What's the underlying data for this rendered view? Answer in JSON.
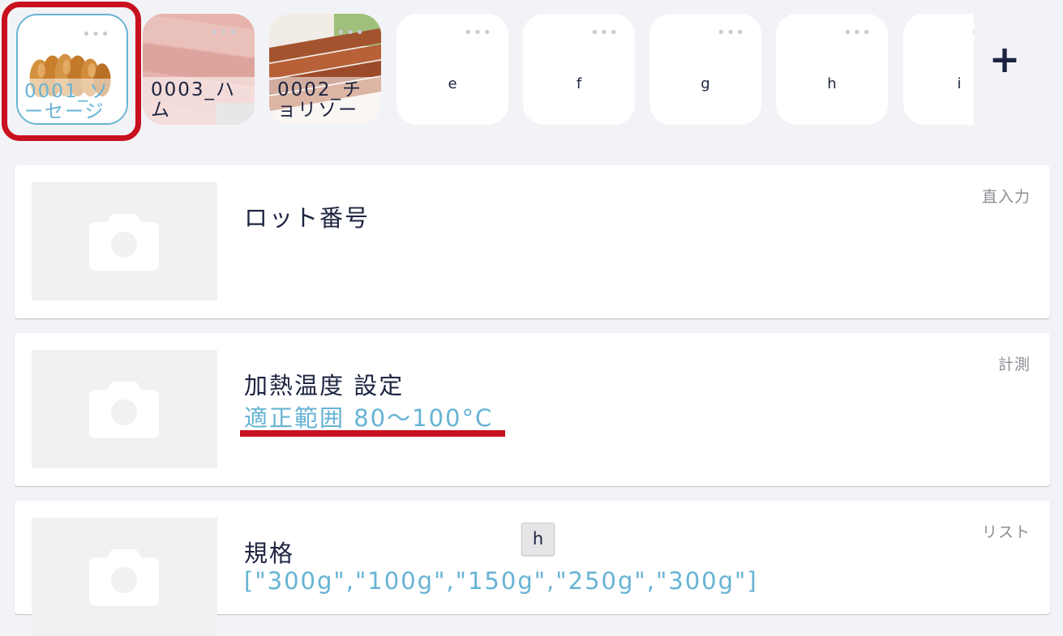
{
  "product_tabs": [
    {
      "name": "0001_ソーセージ",
      "selected": true,
      "menu_icon": "more-dots-icon"
    },
    {
      "name": "0003_ハム",
      "selected": false,
      "menu_icon": "more-dots-icon"
    },
    {
      "name": "0002_チョリソー",
      "selected": false,
      "menu_icon": "more-dots-icon"
    },
    {
      "name": "e",
      "selected": false,
      "menu_icon": "more-dots-icon"
    },
    {
      "name": "f",
      "selected": false,
      "menu_icon": "more-dots-icon"
    },
    {
      "name": "g",
      "selected": false,
      "menu_icon": "more-dots-icon"
    },
    {
      "name": "h",
      "selected": false,
      "menu_icon": "more-dots-icon"
    },
    {
      "name": "i",
      "selected": false,
      "menu_icon": "more-dots-icon"
    }
  ],
  "add_button": {
    "label": "+",
    "icon": "plus-icon"
  },
  "items": [
    {
      "title": "ロット番号",
      "subtitle": "",
      "type": "直入力",
      "image_icon": "camera-icon"
    },
    {
      "title": "加熱温度 設定",
      "subtitle": "適正範囲 80〜100°C",
      "type": "計測",
      "image_icon": "camera-icon"
    },
    {
      "title": "規格",
      "subtitle": "[\"300g\",\"100g\",\"150g\",\"250g\",\"300g\"]",
      "type": "リスト",
      "image_icon": "camera-icon"
    }
  ],
  "key_hint": "h",
  "colors": {
    "accent": "#67b3d4",
    "annotation_red": "#c8101e",
    "text_dark": "#1d2440",
    "background": "#f2f3f7"
  }
}
